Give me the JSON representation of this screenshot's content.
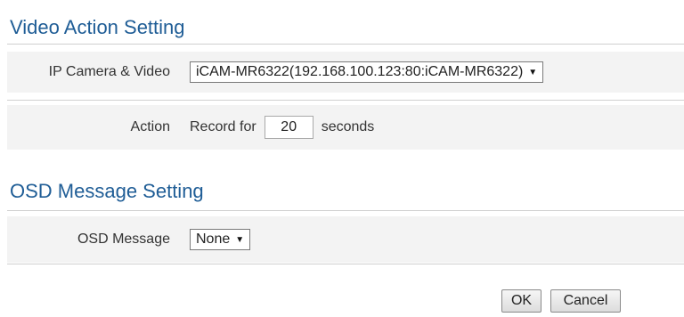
{
  "video_section": {
    "title": "Video Action Setting",
    "camera_label": "IP Camera & Video",
    "camera_value": "iCAM-MR6322(192.168.100.123:80:iCAM-MR6322)",
    "action_label": "Action",
    "record_prefix": "Record for",
    "record_seconds": "20",
    "record_suffix": "seconds"
  },
  "osd_section": {
    "title": "OSD Message Setting",
    "message_label": "OSD Message",
    "message_value": "None"
  },
  "buttons": {
    "ok_label": "OK",
    "cancel_label": "Cancel"
  },
  "icons": {
    "dropdown_arrow": "▼"
  }
}
